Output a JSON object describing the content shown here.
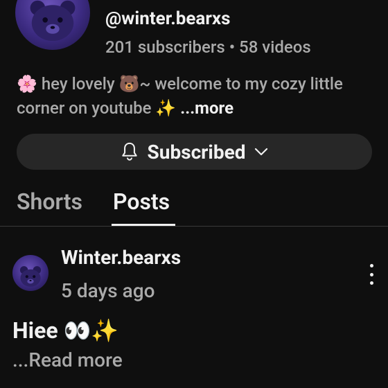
{
  "channel": {
    "handle": "@winter.bearxs",
    "stats": "201 subscribers • 58 videos",
    "bio": "🌸 hey lovely 🐻~ welcome to my cozy little corner on youtube ✨",
    "bio_more": " ...more"
  },
  "subscribe": {
    "label": "Subscribed",
    "icon": "bell-icon",
    "chevron": "chevron-down-icon"
  },
  "tabs": [
    {
      "label": "Shorts",
      "active": false
    },
    {
      "label": "Posts",
      "active": true
    }
  ],
  "post": {
    "author": "Winter.bearxs",
    "time": "5 days ago",
    "text": "Hiee 👀✨",
    "read_more": "...Read more"
  },
  "colors": {
    "background": "#0f0f0f",
    "primary_text": "#f1f1f1",
    "secondary_text": "#aaaaaa",
    "button_bg": "#272727",
    "avatar": "#3b2a80"
  }
}
